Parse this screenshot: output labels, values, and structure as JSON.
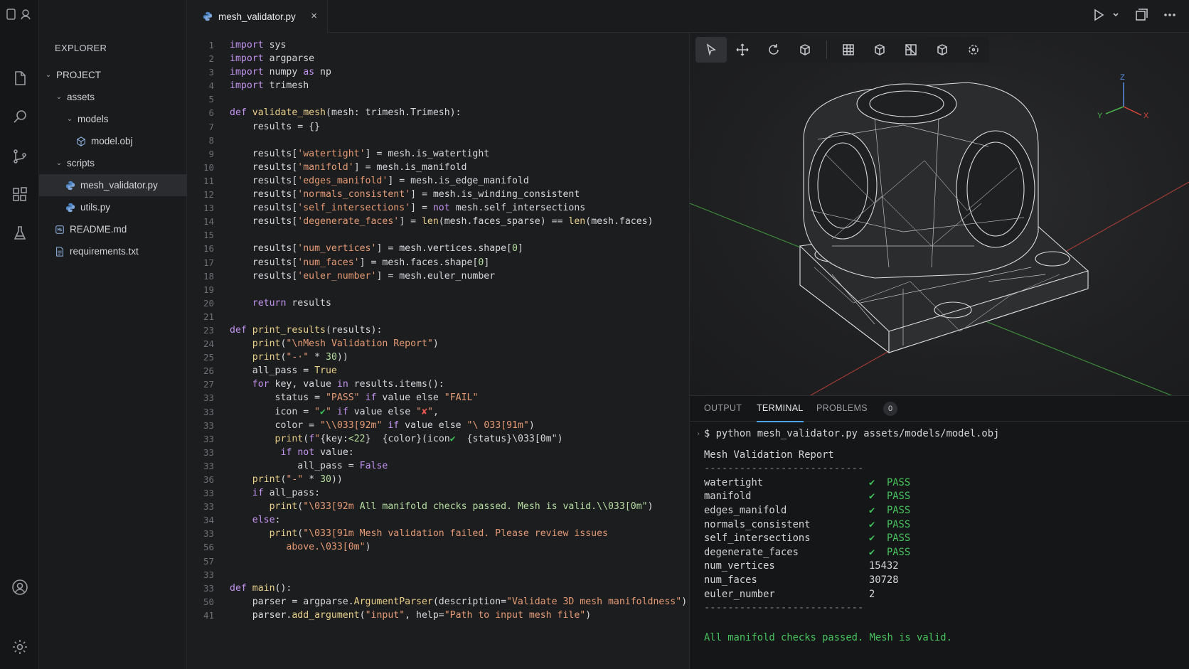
{
  "tab": {
    "filename": "mesh_validator.py",
    "close": "×"
  },
  "explorer": {
    "title": "EXPLORER",
    "items": [
      {
        "label": "PROJECT",
        "type": "folder",
        "depth": 0
      },
      {
        "label": "assets",
        "type": "folder",
        "depth": 1
      },
      {
        "label": "models",
        "type": "folder",
        "depth": 2
      },
      {
        "label": "model.obj",
        "type": "mesh",
        "depth": 3
      },
      {
        "label": "scripts",
        "type": "folder",
        "depth": 1
      },
      {
        "label": "mesh_validator.py",
        "type": "python",
        "depth": 2,
        "selected": true
      },
      {
        "label": "utils.py",
        "type": "python",
        "depth": 2
      },
      {
        "label": "README.md",
        "type": "markdown",
        "depth": 1
      },
      {
        "label": "requirements.txt",
        "type": "text",
        "depth": 1
      }
    ]
  },
  "editor": {
    "lines": [
      {
        "n": "1",
        "html": "<span class=k>import</span> sys"
      },
      {
        "n": "2",
        "html": "<span class=k>import</span> argparse"
      },
      {
        "n": "3",
        "html": "<span class=k>import</span> numpy <span class=k>as</span> np"
      },
      {
        "n": "4",
        "html": "<span class=k>import</span> trimesh"
      },
      {
        "n": "5",
        "html": ""
      },
      {
        "n": "6",
        "html": "<span class=k>def</span> <span class=f>validate_mesh</span>(mesh: trimesh.Trimesh):"
      },
      {
        "n": "7",
        "html": "    results = {}"
      },
      {
        "n": "8",
        "html": ""
      },
      {
        "n": "9",
        "html": "    results[<span class=s>'watertight'</span>] = mesh.is_watertight"
      },
      {
        "n": "10",
        "html": "    results[<span class=s>'manifold'</span>] = mesh.is_manifold"
      },
      {
        "n": "11",
        "html": "    results[<span class=s>'edges_manifold'</span>] = mesh.is_edge_manifold"
      },
      {
        "n": "12",
        "html": "    results[<span class=s>'normals_consistent'</span>] = mesh.is_winding_consistent"
      },
      {
        "n": "13",
        "html": "    results[<span class=s>'self_intersections'</span>] = <span class=k>not</span> mesh.self_intersections"
      },
      {
        "n": "14",
        "html": "    results[<span class=s>'degenerate_faces'</span>] = <span class=f>len</span>(mesh.faces_sparse) == <span class=f>len</span>(mesh.faces)"
      },
      {
        "n": "15",
        "html": ""
      },
      {
        "n": "16",
        "html": "    results[<span class=s>'num_vertices'</span>] = mesh.vertices.shape[<span class=n>0</span>]"
      },
      {
        "n": "17",
        "html": "    results[<span class=s>'num_faces'</span>] = mesh.faces.shape[<span class=n>0</span>]"
      },
      {
        "n": "18",
        "html": "    results[<span class=s>'euler_number'</span>] = mesh.euler_number"
      },
      {
        "n": "19",
        "html": ""
      },
      {
        "n": "20",
        "html": "    <span class=k>return</span> results"
      },
      {
        "n": "21",
        "html": ""
      },
      {
        "n": "23",
        "html": "<span class=k>def</span> <span class=f>print_results</span>(results):"
      },
      {
        "n": "24",
        "html": "    <span class=f>print</span>(<span class=s>\"\\nMesh Validation Report\"</span>)"
      },
      {
        "n": "25",
        "html": "    <span class=f>print</span>(<span class=s>\"-·\"</span> * <span class=n>30</span>))"
      },
      {
        "n": "26",
        "html": "    all_pass = <span class=f>True</span>"
      },
      {
        "n": "27",
        "html": "    <span class=k>for</span> key, value <span class=k>in</span> results.items():"
      },
      {
        "n": "33",
        "html": "        status = <span class=s>\"PASS\"</span> <span class=k>if</span> value else <span class=s>\"FAIL\"</span>"
      },
      {
        "n": "33",
        "html": "        icon = <span class=s>\"<span class=chk>✔</span>\"</span> <span class=k>if</span> value else <span class=s>\"<span style='color:#e5574f'>✘</span>\"</span>,"
      },
      {
        "n": "33",
        "html": "        color = <span class=s>\"\\\\033[92m\"</span> <span class=k>if</span> value else <span class=s>\"\\ 033[91m\"</span>)"
      },
      {
        "n": "33",
        "html": "        <span class=f>print</span>(<span class=k>f</span><span class=s>\"</span>{key:<span class=n>&lt;22</span>}  {color}(icon<span class=chk>✔</span>  {status}\\033[0m\")"
      },
      {
        "n": "33",
        "html": "         <span class=k>if</span> <span class=k>not</span> value:"
      },
      {
        "n": "33",
        "html": "            all_pass = <span class=k>False</span>"
      },
      {
        "n": "36",
        "html": "    <span class=f>print</span>(<span class=s>\"-\"</span> * <span class=n>30</span>))"
      },
      {
        "n": "33",
        "html": "    <span class=k>if</span> all_pass:"
      },
      {
        "n": "33",
        "html": "       <span class=f>print</span>(<span class=s>\"\\033[92m</span> <span class=n>All manifold checks passed. Mesh is valid.\\\\033[0m\"</span>)"
      },
      {
        "n": "34",
        "html": "    <span class=k>else</span>:"
      },
      {
        "n": "33",
        "html": "       <span class=f>print</span>(<span class=s>\"\\033[91m Mesh validation failed. Please review issues</span>"
      },
      {
        "n": "56",
        "html": "          <span class=s>above.\\033[0m\"</span>)"
      },
      {
        "n": "57",
        "html": ""
      },
      {
        "n": "33",
        "html": ""
      },
      {
        "n": "33",
        "html": "<span class=k>def</span> <span class=f>main</span>():"
      },
      {
        "n": "50",
        "html": "    parser = argparse.<span class=f>ArgumentParser</span>(description=<span class=s>\"Validate 3D mesh manifoldness\"</span>)"
      },
      {
        "n": "41",
        "html": "    parser.<span class=f>add_argument</span>(<span class=s>\"input\"</span>, help=<span class=s>\"Path to input mesh file\"</span>)"
      }
    ]
  },
  "viewport": {
    "tools": [
      "select-tool",
      "move-tool",
      "rotate-tool",
      "box-tool",
      "grid-view",
      "cube-view",
      "wireframe-view",
      "solid-view",
      "orbit-view"
    ],
    "axes": {
      "x": "X",
      "y": "Y",
      "z": "Z"
    }
  },
  "panel": {
    "tabs": [
      "OUTPUT",
      "TERMINAL",
      "PROBLEMS"
    ],
    "active_tab": "TERMINAL",
    "problems_count": "0",
    "prompt": "$ python mesh_validator.py assets/models/model.obj",
    "report_title": "Mesh Validation Report",
    "separator": "---------------------------",
    "checks": [
      {
        "key": "watertight",
        "status": "PASS"
      },
      {
        "key": "manifold",
        "status": "PASS"
      },
      {
        "key": "edges_manifold",
        "status": "PASS"
      },
      {
        "key": "normals_consistent",
        "status": "PASS"
      },
      {
        "key": "self_intersections",
        "status": "PASS"
      },
      {
        "key": "degenerate_faces",
        "status": "PASS"
      }
    ],
    "stats": [
      {
        "key": "num_vertices",
        "value": "15432"
      },
      {
        "key": "num_faces",
        "value": "30728"
      },
      {
        "key": "euler_number",
        "value": "2"
      }
    ],
    "final_message": "All manifold checks passed. Mesh is valid."
  }
}
